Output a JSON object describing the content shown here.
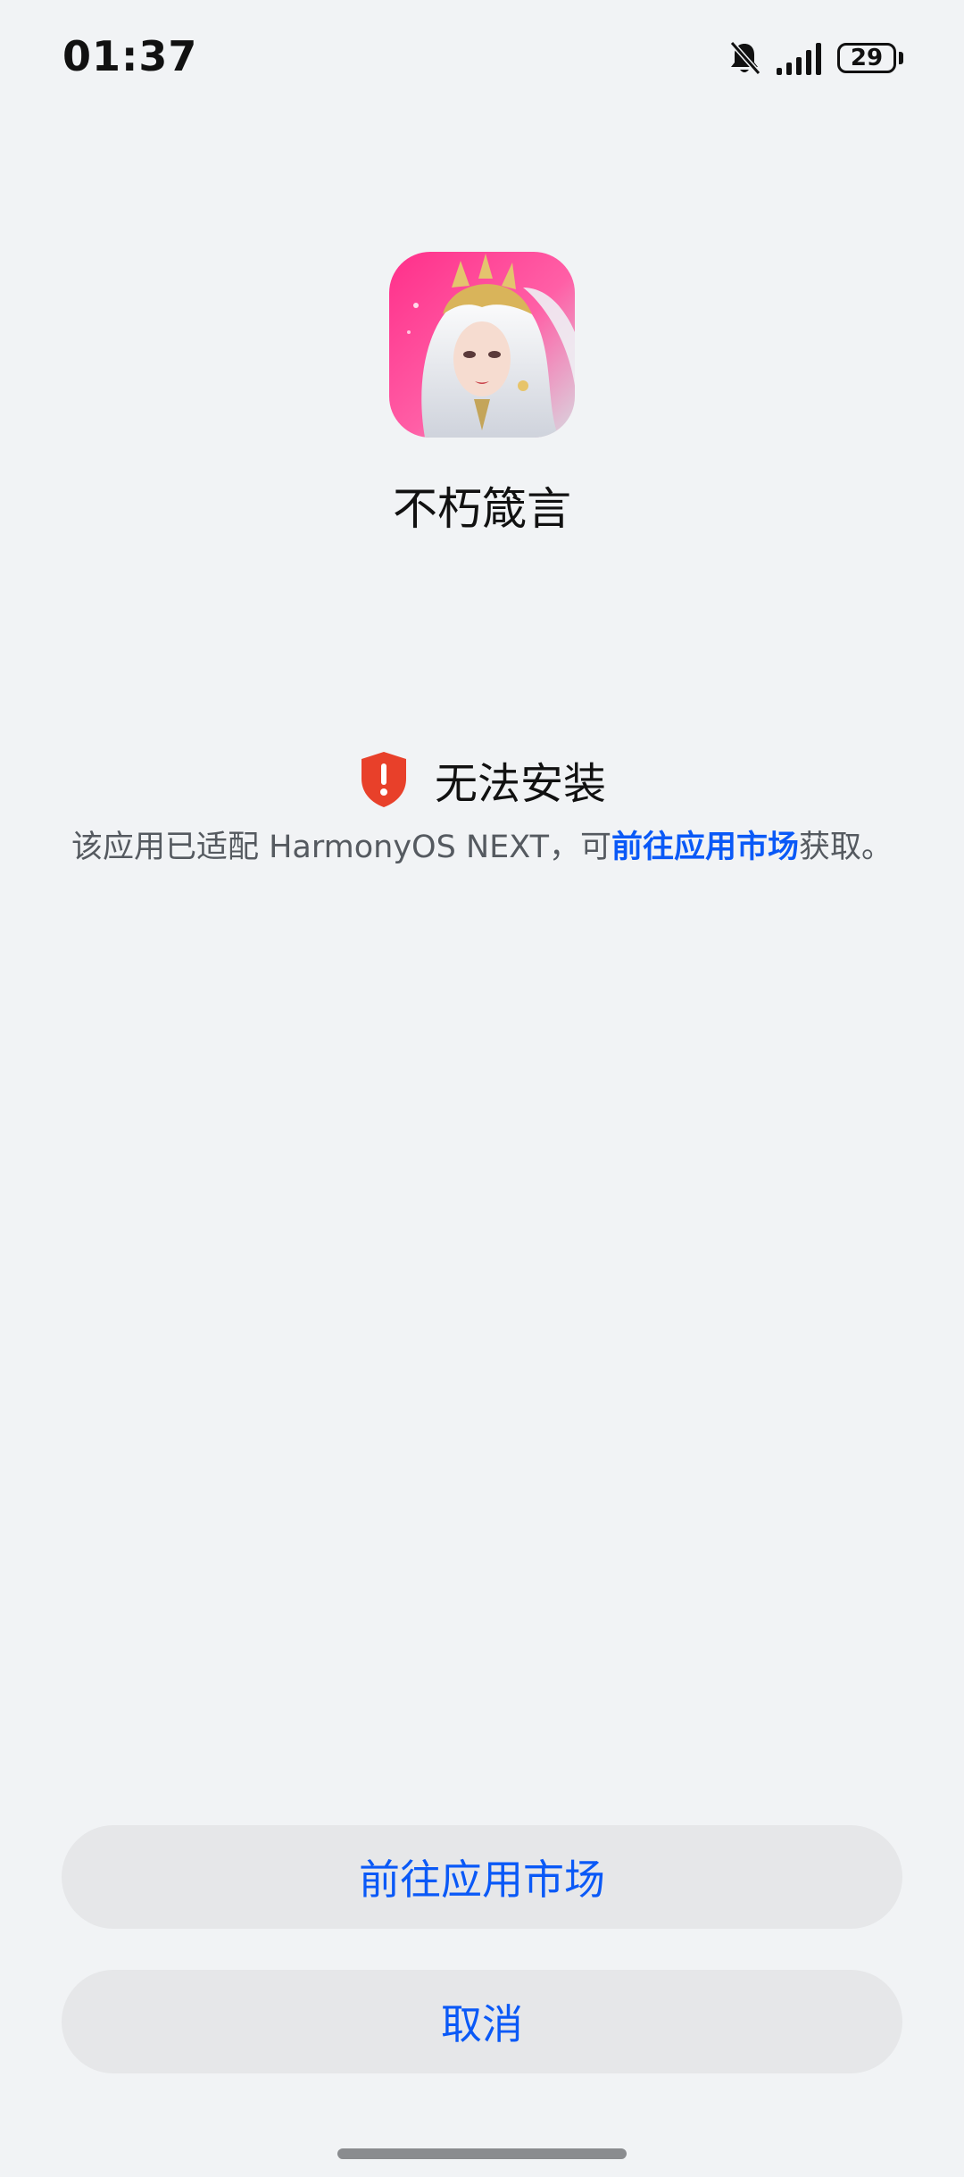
{
  "status_bar": {
    "time": "01:37",
    "battery": "29",
    "icons": [
      "bell-mute-icon",
      "signal-icon",
      "battery-icon"
    ]
  },
  "app": {
    "name": "不朽箴言",
    "icon": "app-icon-fantasy-portrait"
  },
  "error": {
    "icon": "shield-alert-icon",
    "title": "无法安装",
    "message_prefix": "该应用已适配 HarmonyOS NEXT，可",
    "message_link": "前往应用市场",
    "message_suffix": "获取。"
  },
  "buttons": {
    "market": "前往应用市场",
    "cancel": "取消"
  },
  "colors": {
    "background": "#f1f3f5",
    "accent": "#0a59f7",
    "button_bg": "#e6e7e9",
    "alert_red": "#e8402a"
  }
}
